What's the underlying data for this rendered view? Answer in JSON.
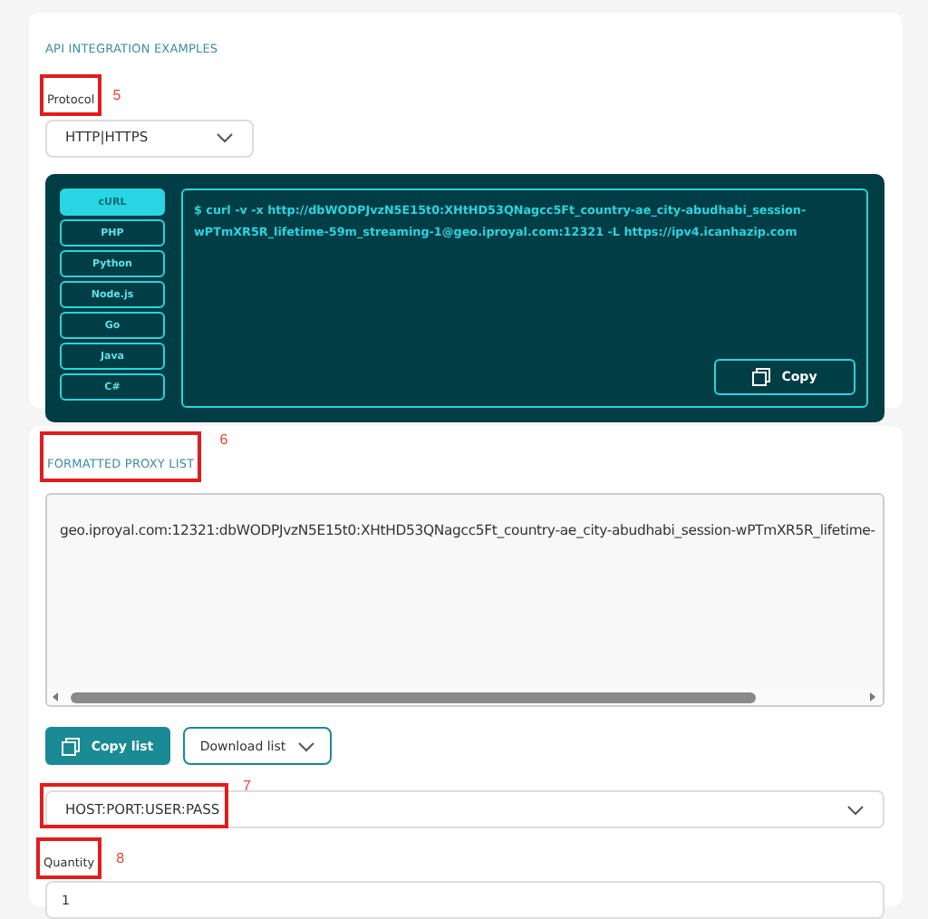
{
  "api_section": {
    "title": "API INTEGRATION EXAMPLES",
    "protocol_label": "Protocol",
    "protocol_callout": "5",
    "protocol_select": {
      "value": "HTTP|HTTPS"
    },
    "language_tabs": [
      {
        "label": "cURL",
        "selected": true
      },
      {
        "label": "PHP",
        "selected": false
      },
      {
        "label": "Python",
        "selected": false
      },
      {
        "label": "Node.js",
        "selected": false
      },
      {
        "label": "Go",
        "selected": false
      },
      {
        "label": "Java",
        "selected": false
      },
      {
        "label": "C#",
        "selected": false
      }
    ],
    "code_lines": [
      "$ curl -v -x http://dbWODPJvzN5E15t0:XHtHD53QNagcc5Ft_country-ae_city-abudhabi_session-",
      "wPTmXR5R_lifetime-59m_streaming-1@geo.iproyal.com:12321 -L https://ipv4.icanhazip.com"
    ],
    "copy_button": "Copy"
  },
  "proxy_section": {
    "title": "FORMATTED PROXY LIST",
    "title_callout": "6",
    "proxy_text": "geo.iproyal.com:12321:dbWODPJvzN5E15t0:XHtHD53QNagcc5Ft_country-ae_city-abudhabi_session-wPTmXR5R_lifetime-",
    "copy_list_button": "Copy list",
    "download_button": "Download list",
    "format_select": {
      "value": "HOST:PORT:USER:PASS"
    },
    "format_callout": "7",
    "quantity_label": "Quantity",
    "quantity_callout": "8",
    "quantity_input": {
      "value": "1"
    }
  }
}
